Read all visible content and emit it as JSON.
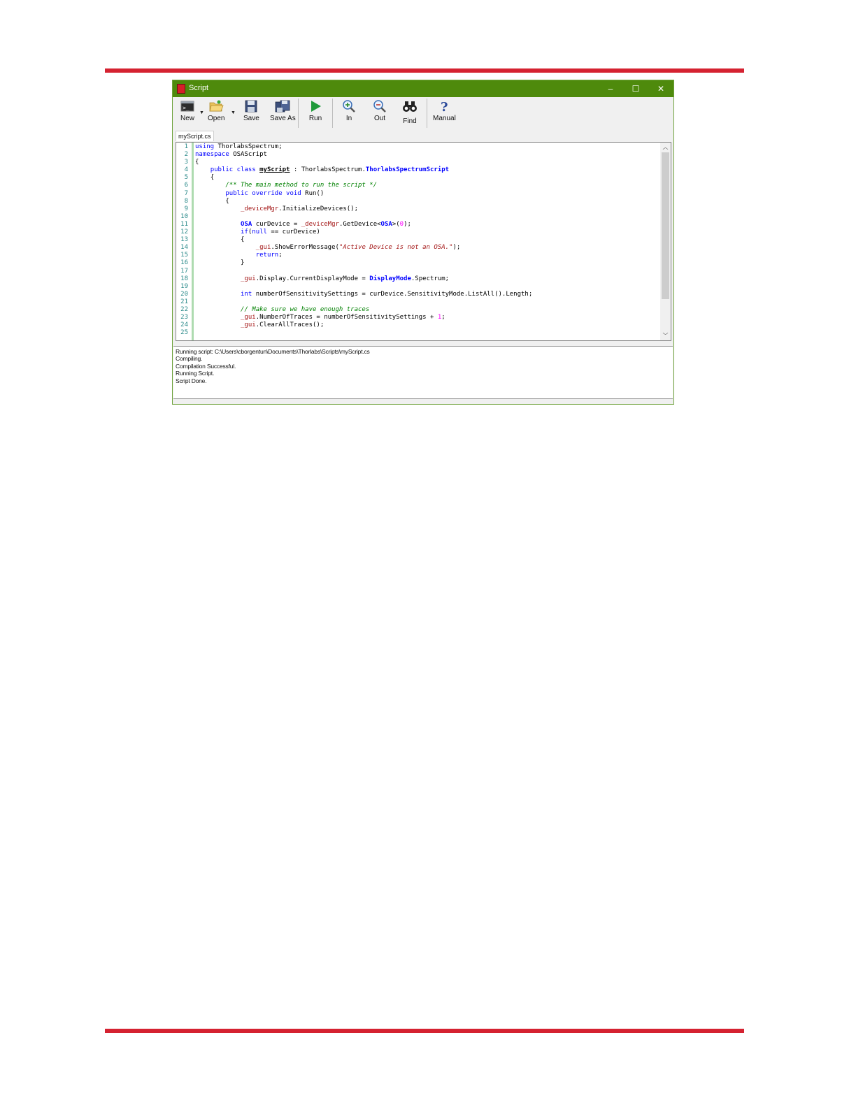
{
  "window": {
    "title": "Script",
    "controls": {
      "minimize": "–",
      "maximize": "☐",
      "close": "✕"
    }
  },
  "toolbar": {
    "buttons": [
      {
        "label": "New",
        "icon": "new-script-icon"
      },
      {
        "label": "Open",
        "icon": "open-folder-icon"
      },
      {
        "label": "Save",
        "icon": "save-disk-icon"
      },
      {
        "label": "Save As",
        "icon": "save-as-icon"
      },
      {
        "label": "Run",
        "icon": "run-play-icon"
      },
      {
        "label": "In",
        "icon": "zoom-in-icon"
      },
      {
        "label": "Out",
        "icon": "zoom-out-icon"
      },
      {
        "label": "Find",
        "icon": "binoculars-icon"
      },
      {
        "label": "Manual",
        "icon": "help-question-icon"
      }
    ]
  },
  "tab": {
    "label": "myScript.cs"
  },
  "editor": {
    "lines": [
      {
        "n": "1"
      },
      {
        "n": "2"
      },
      {
        "n": "3"
      },
      {
        "n": "4"
      },
      {
        "n": "5"
      },
      {
        "n": "6"
      },
      {
        "n": "7"
      },
      {
        "n": "8"
      },
      {
        "n": "9"
      },
      {
        "n": "10"
      },
      {
        "n": "11"
      },
      {
        "n": "12"
      },
      {
        "n": "13"
      },
      {
        "n": "14"
      },
      {
        "n": "15"
      },
      {
        "n": "16"
      },
      {
        "n": "17"
      },
      {
        "n": "18"
      },
      {
        "n": "19"
      },
      {
        "n": "20"
      },
      {
        "n": "21"
      },
      {
        "n": "22"
      },
      {
        "n": "23"
      },
      {
        "n": "24"
      },
      {
        "n": "25"
      }
    ],
    "code": {
      "l1_kw": "using",
      "l1_rest": " ThorlabsSpectrum;",
      "l2_kw": "namespace",
      "l2_rest": " OSAScript",
      "l3": "{",
      "l4_kw": "public class",
      "l4_cls": "myScript",
      "l4_mid": " : ThorlabsSpectrum.",
      "l4_type": "ThorlabsSpectrumScript",
      "l5": "{",
      "l6_cm": "/** The main method to run the script */",
      "l7_kw": "public override void",
      "l7_rest": " Run()",
      "l8": "{",
      "l9_fld": "_deviceMgr",
      "l9_rest": ".InitializeDevices();",
      "l11_ty": "OSA",
      "l11_a": " curDevice = ",
      "l11_fld": "_deviceMgr",
      "l11_b": ".GetDevice<",
      "l11_ty2": "OSA",
      "l11_c": ">(",
      "l11_num": "0",
      "l11_d": ");",
      "l12_kw": "if",
      "l12_a": "(",
      "l12_kw2": "null",
      "l12_b": " == curDevice)",
      "l13": "{",
      "l14_fld": "_gui",
      "l14_a": ".ShowErrorMessage(",
      "l14_st": "\"Active Device is not an OSA.\"",
      "l14_b": ");",
      "l15_kw": "return",
      "l15_rest": ";",
      "l16": "}",
      "l18_fld": "_gui",
      "l18_a": ".Display.CurrentDisplayMode = ",
      "l18_ty": "DisplayMode",
      "l18_b": ".Spectrum;",
      "l20_kw": "int",
      "l20_rest": " numberOfSensitivitySettings = curDevice.SensitivityMode.ListAll().Length;",
      "l22_cm": "// Make sure we have enough traces",
      "l23_fld": "_gui",
      "l23_a": ".NumberOfTraces = numberOfSensitivitySettings + ",
      "l23_num": "1",
      "l23_b": ";",
      "l24_fld": "_gui",
      "l24_rest": ".ClearAllTraces();"
    }
  },
  "output": {
    "lines": [
      "Running script: C:\\Users\\cborgentun\\Documents\\Thorlabs\\Scripts\\myScript.cs",
      "Compiling.",
      "Compilation Successful.",
      "Running Script.",
      "Script Done."
    ]
  },
  "colors": {
    "page_rule": "#d52231",
    "titlebar": "#4e8a0c",
    "keyword": "#0000ff",
    "comment": "#008000",
    "string": "#a31515"
  }
}
